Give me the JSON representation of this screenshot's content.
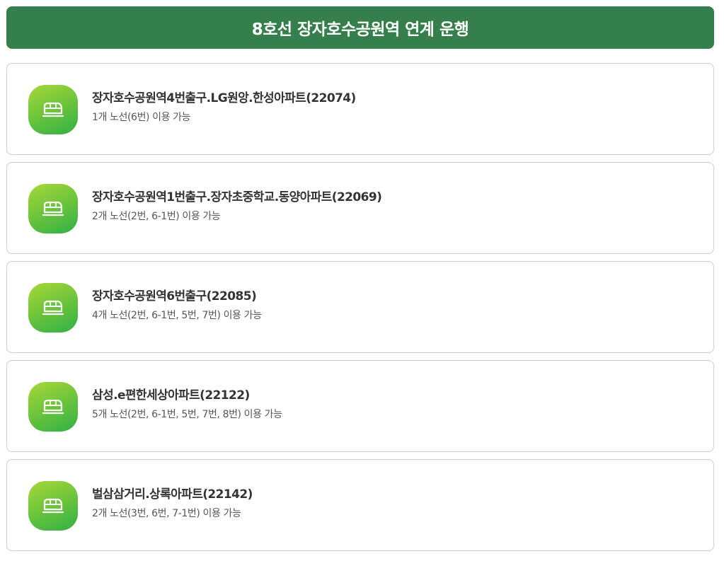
{
  "header": {
    "title": "8호선 장자호수공원역 연계 운행"
  },
  "stops": [
    {
      "icon": "bus-icon",
      "name": "장자호수공원역4번출구.LG원앙.한성아파트(22074)",
      "routes": "1개 노선(6번) 이용 가능"
    },
    {
      "icon": "bus-icon",
      "name": "장자호수공원역1번출구.장자초중학교.동양아파트(22069)",
      "routes": "2개 노선(2번, 6-1번) 이용 가능"
    },
    {
      "icon": "bus-icon",
      "name": "장자호수공원역6번출구(22085)",
      "routes": "4개 노선(2번, 6-1번, 5번, 7번) 이용 가능"
    },
    {
      "icon": "bus-icon",
      "name": "삼성.e편한세상아파트(22122)",
      "routes": "5개 노선(2번, 6-1번, 5번, 7번, 8번) 이용 가능"
    },
    {
      "icon": "bus-icon",
      "name": "벌삼삼거리.상록아파트(22142)",
      "routes": "2개 노선(3번, 6번, 7-1번) 이용 가능"
    }
  ],
  "colors": {
    "header_bg": "#357f4c",
    "badge_gradient_start": "#a8d839",
    "badge_gradient_end": "#2fb046",
    "card_border": "#cfcfcf"
  }
}
